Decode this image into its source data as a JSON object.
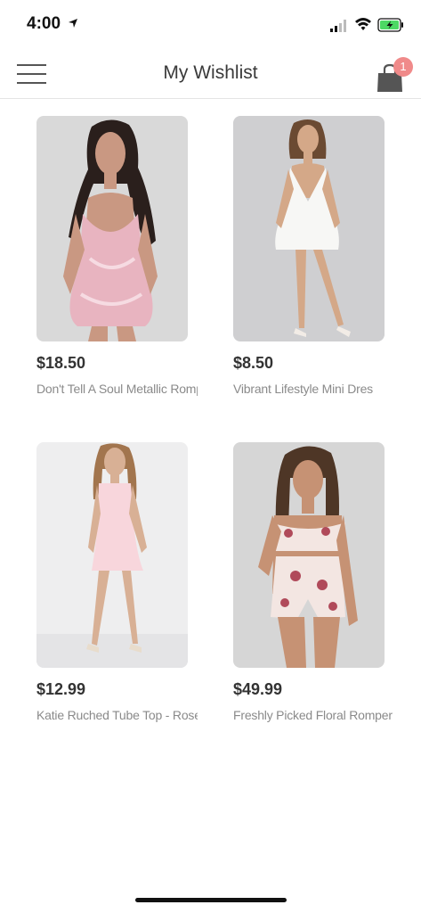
{
  "status_bar": {
    "time": "4:00"
  },
  "header": {
    "title": "My Wishlist",
    "cart_count": "1"
  },
  "products": [
    {
      "price": "$18.50",
      "name": "Don't Tell A Soul Metallic Rompe",
      "image_bg": "#d9d9d9",
      "dress_color": "#e8b4c0"
    },
    {
      "price": "$8.50",
      "name": "Vibrant Lifestyle Mini Dres",
      "image_bg": "#cfcfd1",
      "dress_color": "#f7f7f5"
    },
    {
      "price": "$12.99",
      "name": "Katie Ruched Tube Top - Rose",
      "image_bg": "#eeeeef",
      "dress_color": "#f8d6dc"
    },
    {
      "price": "$49.99",
      "name": "Freshly Picked Floral Romper",
      "image_bg": "#d6d6d6",
      "dress_color": "#f3e6e2"
    }
  ]
}
